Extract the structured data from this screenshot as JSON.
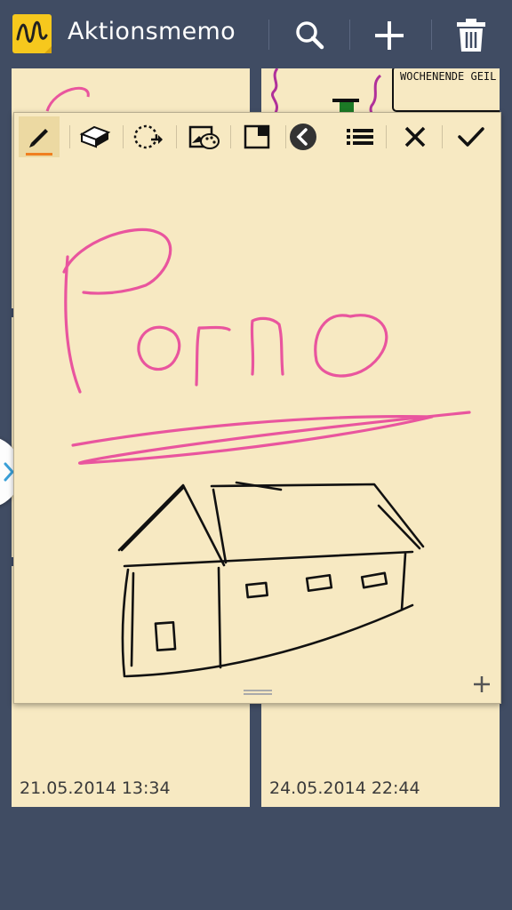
{
  "app": {
    "title": "Aktionsmemo",
    "icon": "handwriting-app-icon"
  },
  "appbar_actions": [
    {
      "name": "search",
      "icon": "search-icon"
    },
    {
      "name": "add",
      "icon": "plus-icon"
    },
    {
      "name": "delete",
      "icon": "trash-icon"
    }
  ],
  "memos": [
    {
      "date": "21.05.2014 13:34"
    },
    {
      "date": "24.05.2014 22:44"
    }
  ],
  "background_memo_text": "WOCHENENDE GEIL ... SAUFEN",
  "editor": {
    "toolbar": [
      {
        "name": "pen",
        "icon": "pen-icon",
        "active": true
      },
      {
        "name": "eraser",
        "icon": "eraser-icon"
      },
      {
        "name": "selection",
        "icon": "lasso-select-icon"
      },
      {
        "name": "background",
        "icon": "image-palette-icon"
      },
      {
        "name": "resize",
        "icon": "window-resize-icon"
      },
      {
        "name": "back",
        "icon": "back-circle-icon"
      },
      {
        "name": "menu",
        "icon": "list-icon"
      },
      {
        "name": "close",
        "icon": "close-icon"
      },
      {
        "name": "done",
        "icon": "check-icon"
      }
    ],
    "handwriting_text": "Porno",
    "drawing": "house-sketch"
  },
  "colors": {
    "background": "#404c63",
    "note_paper": "#f7e9c2",
    "ink_pink": "#e9559e",
    "ink_black": "#111111",
    "pen_active_underline": "#f07f1f"
  }
}
